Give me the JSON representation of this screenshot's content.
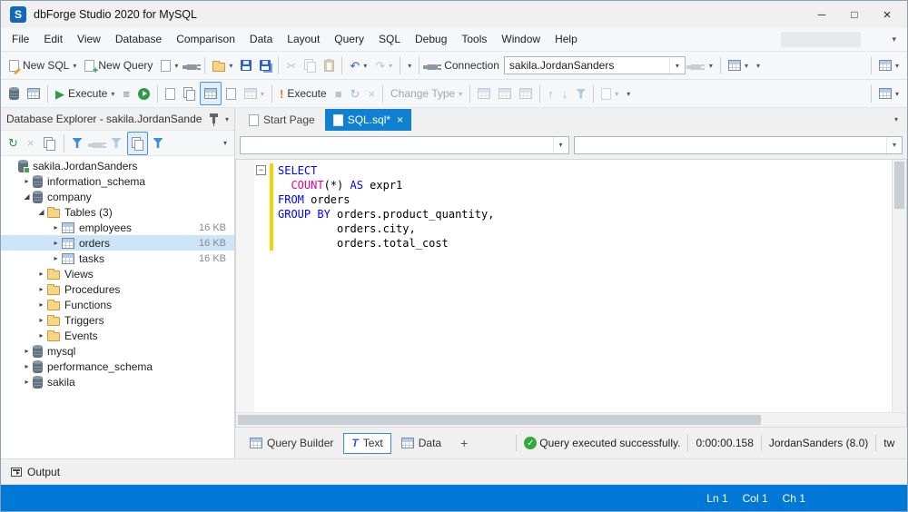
{
  "colors": {
    "accent": "#1080d0",
    "statusbar-bg": "#0078d7",
    "keyword": "#0000ff",
    "function": "#e8009c",
    "selection-bg": "#cde6f7",
    "changebar": "#f2d40e",
    "success": "#36a93c"
  },
  "icons": {
    "logo_letter": "S",
    "minimize": "─",
    "maximize": "□",
    "close": "×",
    "dropdown": "▾",
    "collapsed": "▸",
    "expanded": "◢",
    "undo": "↶",
    "redo": "↷",
    "play": "▶",
    "stop": "■",
    "refresh": "↻",
    "cancel": "×",
    "cut": "✂",
    "check": "✓",
    "exclaim": "!",
    "plus": "+",
    "minus": "−",
    "menu_lines": "≡",
    "sort_up": "↑",
    "sort_down": "↓",
    "text_tab": "T"
  },
  "window": {
    "title": "dbForge Studio 2020 for MySQL"
  },
  "menubar": {
    "items": [
      "File",
      "Edit",
      "View",
      "Database",
      "Comparison",
      "Data",
      "Layout",
      "Query",
      "SQL",
      "Debug",
      "Tools",
      "Window",
      "Help"
    ]
  },
  "toolbar1": {
    "new_sql": "New SQL",
    "new_query": "New Query",
    "connection_label": "Connection",
    "connection_value": "sakila.JordanSanders"
  },
  "toolbar2": {
    "execute": "Execute",
    "execute2": "Execute",
    "change_type": "Change Type"
  },
  "explorer": {
    "title": "Database Explorer - sakila.JordanSanders",
    "tree": [
      {
        "level": 0,
        "icon": "server",
        "label": "sakila.JordanSanders",
        "exp": null
      },
      {
        "level": 1,
        "icon": "db",
        "label": "information_schema",
        "exp": "collapsed"
      },
      {
        "level": 1,
        "icon": "db",
        "label": "company",
        "exp": "expanded"
      },
      {
        "level": 2,
        "icon": "folder",
        "label": "Tables (3)",
        "exp": "expanded"
      },
      {
        "level": 3,
        "icon": "table",
        "label": "employees",
        "size": "16 KB",
        "exp": "collapsed"
      },
      {
        "level": 3,
        "icon": "table",
        "label": "orders",
        "size": "16 KB",
        "exp": "collapsed",
        "selected": true
      },
      {
        "level": 3,
        "icon": "table",
        "label": "tasks",
        "size": "16 KB",
        "exp": "collapsed"
      },
      {
        "level": 2,
        "icon": "folder",
        "label": "Views",
        "exp": "collapsed"
      },
      {
        "level": 2,
        "icon": "folder",
        "label": "Procedures",
        "exp": "collapsed"
      },
      {
        "level": 2,
        "icon": "folder",
        "label": "Functions",
        "exp": "collapsed"
      },
      {
        "level": 2,
        "icon": "folder",
        "label": "Triggers",
        "exp": "collapsed"
      },
      {
        "level": 2,
        "icon": "folder",
        "label": "Events",
        "exp": "collapsed"
      },
      {
        "level": 1,
        "icon": "db",
        "label": "mysql",
        "exp": "collapsed"
      },
      {
        "level": 1,
        "icon": "db",
        "label": "performance_schema",
        "exp": "collapsed"
      },
      {
        "level": 1,
        "icon": "db",
        "label": "sakila",
        "exp": "collapsed"
      }
    ]
  },
  "tabs": [
    {
      "label": "Start Page"
    },
    {
      "label": "SQL.sql*"
    }
  ],
  "combos": {
    "combo1_value": "",
    "combo2_value": ""
  },
  "editor": {
    "lines": [
      [
        {
          "c": "kw",
          "v": "SELECT"
        }
      ],
      [
        {
          "c": "pl",
          "v": "  "
        },
        {
          "c": "fn",
          "v": "COUNT"
        },
        {
          "c": "pl",
          "v": "(*) "
        },
        {
          "c": "kw",
          "v": "AS"
        },
        {
          "c": "pl",
          "v": " expr1"
        }
      ],
      [
        {
          "c": "kw",
          "v": "FROM"
        },
        {
          "c": "pl",
          "v": " orders"
        }
      ],
      [
        {
          "c": "kw",
          "v": "GROUP BY"
        },
        {
          "c": "pl",
          "v": " orders.product_quantity,"
        }
      ],
      [
        {
          "c": "pl",
          "v": "         orders.city,"
        }
      ],
      [
        {
          "c": "pl",
          "v": "         orders.total_cost"
        }
      ]
    ]
  },
  "bottom": {
    "tabs": [
      "Query Builder",
      "Text",
      "Data"
    ],
    "add": "+",
    "message": "Query executed successfully.",
    "time": "0:00:00.158",
    "connection": "JordanSanders (8.0)",
    "extra": "tw"
  },
  "output": {
    "label": "Output"
  },
  "statusbar": {
    "ln": "Ln 1",
    "col": "Col 1",
    "ch": "Ch 1"
  }
}
